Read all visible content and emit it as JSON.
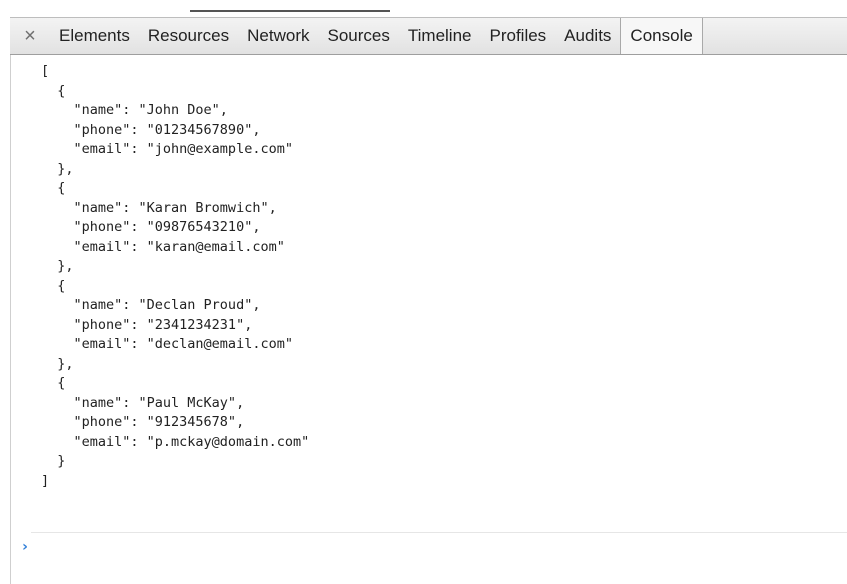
{
  "toolbar": {
    "close_glyph": "×",
    "tabs": [
      {
        "label": "Elements"
      },
      {
        "label": "Resources"
      },
      {
        "label": "Network"
      },
      {
        "label": "Sources"
      },
      {
        "label": "Timeline"
      },
      {
        "label": "Profiles"
      },
      {
        "label": "Audits"
      },
      {
        "label": "Console"
      }
    ],
    "active_tab": "Console"
  },
  "console": {
    "output_lines": [
      "[",
      "  {",
      "    \"name\": \"John Doe\",",
      "    \"phone\": \"01234567890\",",
      "    \"email\": \"john@example.com\"",
      "  },",
      "  {",
      "    \"name\": \"Karan Bromwich\",",
      "    \"phone\": \"09876543210\",",
      "    \"email\": \"karan@email.com\"",
      "  },",
      "  {",
      "    \"name\": \"Declan Proud\",",
      "    \"phone\": \"2341234231\",",
      "    \"email\": \"declan@email.com\"",
      "  },",
      "  {",
      "    \"name\": \"Paul McKay\",",
      "    \"phone\": \"912345678\",",
      "    \"email\": \"p.mckay@domain.com\"",
      "  }",
      "]"
    ],
    "prompt_glyph": "›",
    "input_value": ""
  },
  "colors": {
    "prompt_accent": "#2f7ed8",
    "toolbar_bg": "#e9e9e9",
    "text": "#222222"
  }
}
